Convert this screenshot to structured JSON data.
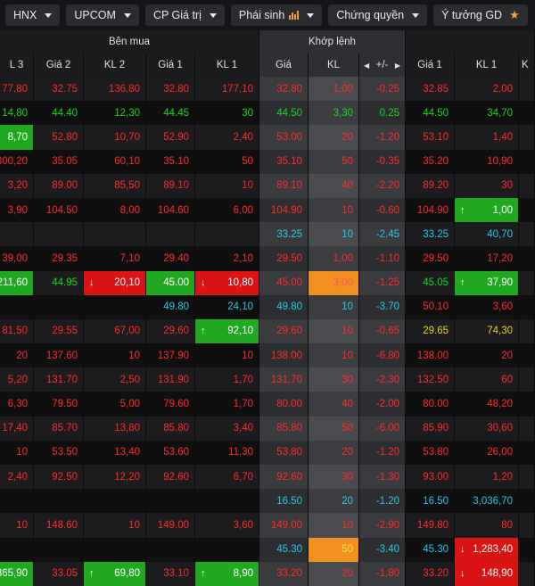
{
  "tabs": [
    {
      "label": "HNX",
      "icon": "caret-down-icon"
    },
    {
      "label": "UPCOM",
      "icon": "caret-down-icon"
    },
    {
      "label": "CP Giá trị",
      "icon": "caret-down-icon"
    },
    {
      "label": "Phái sinh",
      "icon": "bar-chart-icon"
    },
    {
      "label": "Chứng quyền",
      "icon": "caret-down-icon"
    },
    {
      "label": "Ý tưởng GD",
      "icon": "star-icon"
    }
  ],
  "group_headers": {
    "buy": "Bên mua",
    "match": "Khớp lệnh"
  },
  "columns": [
    "L 3",
    "Giá 2",
    "KL 2",
    "Giá 1",
    "KL 1",
    "Giá",
    "KL",
    "+/-",
    "Giá 1",
    "KL 1"
  ],
  "colors": {
    "up": "#1ad61a",
    "down": "#ff2b2b",
    "ref": "#e8d020",
    "floor": "#27c8e8",
    "accent": "#f09020"
  },
  "rows": [
    [
      "77,80",
      "32.75",
      "136,80",
      "32.80",
      "177,10",
      "32.80",
      "1,00",
      "-0.25",
      "32.85",
      "2,00"
    ],
    [
      "14,80",
      "44.40",
      "12,30",
      "44.45",
      "30",
      "44.50",
      "3,30",
      "0.25",
      "44.50",
      "34,70"
    ],
    [
      "8,70",
      "52.80",
      "10,70",
      "52.90",
      "2,40",
      "53.00",
      "20",
      "-1.20",
      "53.10",
      "1,40"
    ],
    [
      "300,20",
      "35.05",
      "60,10",
      "35.10",
      "50",
      "35.10",
      "50",
      "-0.35",
      "35.20",
      "10,90"
    ],
    [
      "3,20",
      "89.00",
      "85,50",
      "89.10",
      "10",
      "89.10",
      "40",
      "-2.20",
      "89.20",
      "30"
    ],
    [
      "3,90",
      "104.50",
      "8,00",
      "104.60",
      "6,00",
      "104.90",
      "10",
      "-0.60",
      "104.90",
      "1,00"
    ],
    [
      "",
      "",
      "",
      "",
      "",
      "33.25",
      "10",
      "-2.45",
      "33.25",
      "40,70"
    ],
    [
      "39,00",
      "29.35",
      "7,10",
      "29.40",
      "2,10",
      "29.50",
      "1,00",
      "-1.10",
      "29.50",
      "17,20"
    ],
    [
      "211,60",
      "44.95",
      "20,10",
      "45.00",
      "10,80",
      "45.00",
      "3,00",
      "-1.25",
      "45.05",
      "37,90"
    ],
    [
      "",
      "",
      "",
      "49.80",
      "24,10",
      "49.80",
      "10",
      "-3.70",
      "50.10",
      "3,60"
    ],
    [
      "81,50",
      "29.55",
      "67,00",
      "29.60",
      "92,10",
      "29.60",
      "10",
      "-0.65",
      "29.65",
      "74,30"
    ],
    [
      "20",
      "137.60",
      "10",
      "137.90",
      "10",
      "138.00",
      "10",
      "-6.80",
      "138.00",
      "20"
    ],
    [
      "5,20",
      "131.70",
      "2,50",
      "131.90",
      "1,70",
      "131.70",
      "30",
      "-2.30",
      "132.50",
      "60"
    ],
    [
      "6,30",
      "79.50",
      "5,00",
      "79.60",
      "1,70",
      "80.00",
      "40",
      "-2.00",
      "80.00",
      "48,20"
    ],
    [
      "17,40",
      "85.70",
      "13,80",
      "85.80",
      "3,40",
      "85.80",
      "50",
      "-6.00",
      "85.90",
      "30,60"
    ],
    [
      "10",
      "53.50",
      "13,40",
      "53.60",
      "11,30",
      "53.80",
      "20",
      "-1.20",
      "53.80",
      "26,00"
    ],
    [
      "2,40",
      "92.50",
      "12,20",
      "92.60",
      "6,70",
      "92.60",
      "30",
      "-1.30",
      "93.00",
      "1,20"
    ],
    [
      "",
      "",
      "",
      "",
      "",
      "16.50",
      "20",
      "-1.20",
      "16.50",
      "3,036,70"
    ],
    [
      "10",
      "148.60",
      "10",
      "149.00",
      "3,60",
      "149.00",
      "10",
      "-2.90",
      "149.80",
      "80"
    ],
    [
      "",
      "",
      "",
      "",
      "",
      "45.30",
      "50",
      "-3.40",
      "45.30",
      "1,283,40"
    ],
    [
      "365,90",
      "33.05",
      "69,80",
      "33.10",
      "8,90",
      "33.20",
      "20",
      "-1.80",
      "33.20",
      "148,90"
    ]
  ]
}
